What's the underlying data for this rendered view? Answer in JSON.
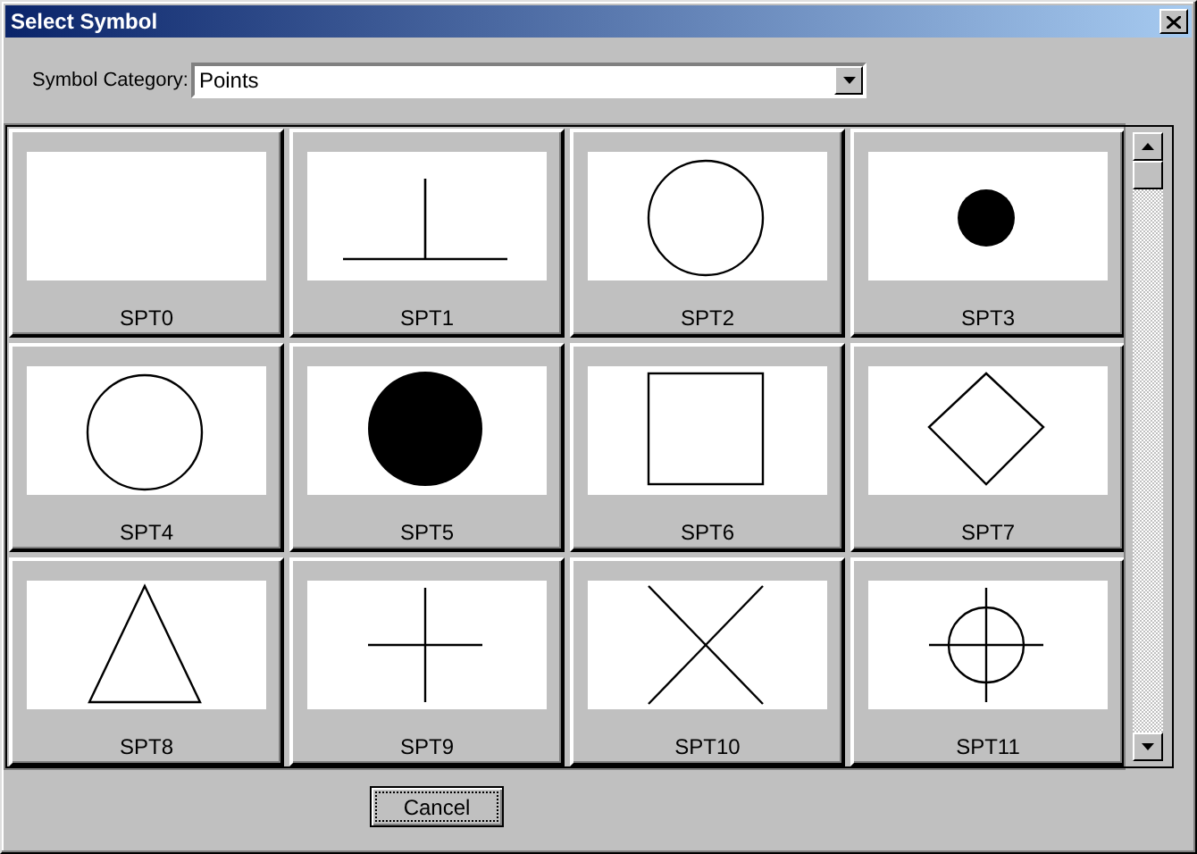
{
  "window": {
    "title": "Select Symbol"
  },
  "category": {
    "label": "Symbol Category:",
    "value": "Points"
  },
  "symbols": [
    {
      "label": "SPT0",
      "kind": "blank"
    },
    {
      "label": "SPT1",
      "kind": "tee"
    },
    {
      "label": "SPT2",
      "kind": "circle"
    },
    {
      "label": "SPT3",
      "kind": "dot"
    },
    {
      "label": "SPT4",
      "kind": "circle"
    },
    {
      "label": "SPT5",
      "kind": "disc"
    },
    {
      "label": "SPT6",
      "kind": "square"
    },
    {
      "label": "SPT7",
      "kind": "diamond"
    },
    {
      "label": "SPT8",
      "kind": "triangle"
    },
    {
      "label": "SPT9",
      "kind": "plus"
    },
    {
      "label": "SPT10",
      "kind": "cross"
    },
    {
      "label": "SPT11",
      "kind": "crosshair"
    }
  ],
  "buttons": [
    "Cancel"
  ]
}
